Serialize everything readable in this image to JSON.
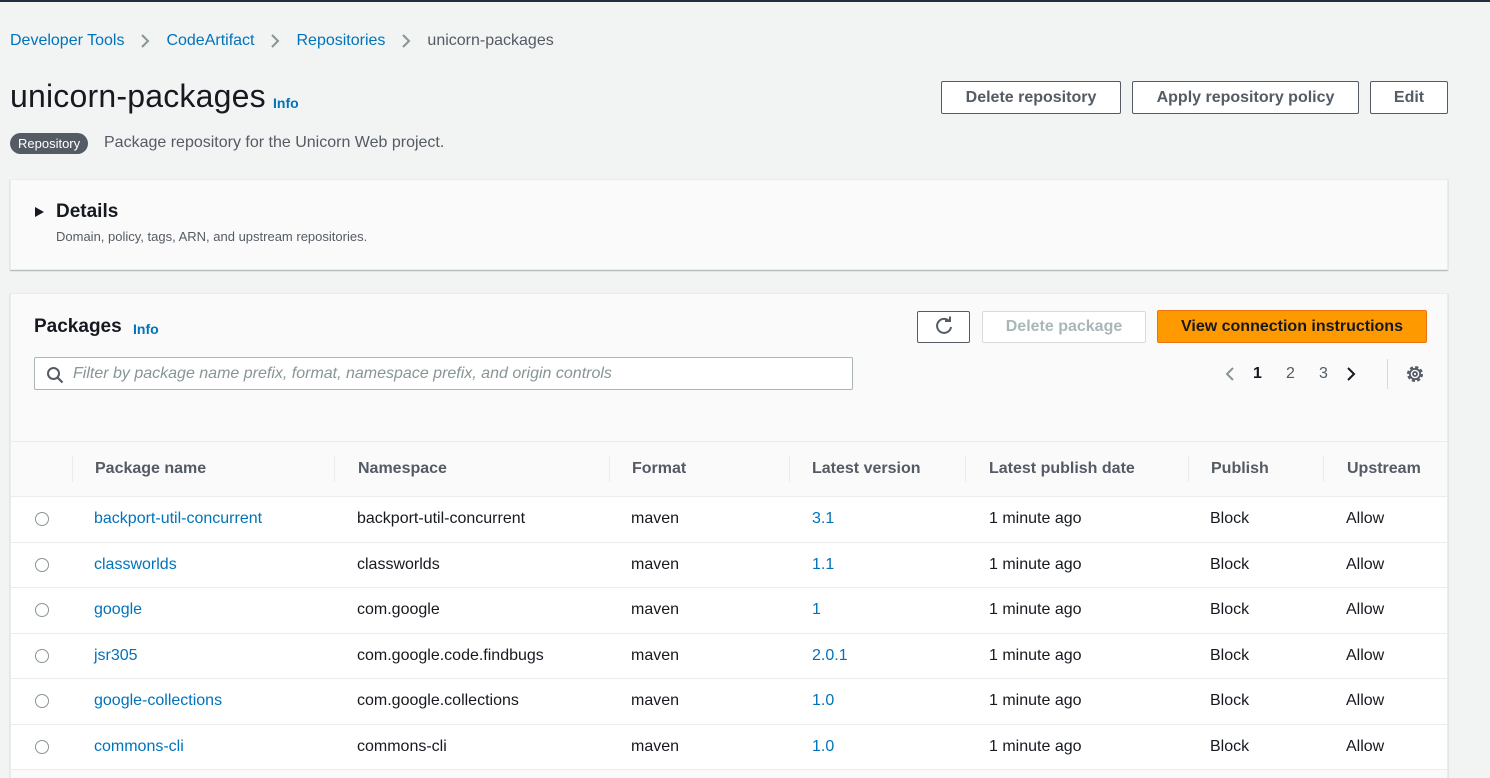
{
  "breadcrumb": {
    "items": [
      "Developer Tools",
      "CodeArtifact",
      "Repositories"
    ],
    "current": "unicorn-packages"
  },
  "header": {
    "title": "unicorn-packages",
    "info_label": "Info",
    "badge": "Repository",
    "description": "Package repository for the Unicorn Web project.",
    "buttons": {
      "delete": "Delete repository",
      "apply_policy": "Apply repository policy",
      "edit": "Edit"
    }
  },
  "details": {
    "title": "Details",
    "description": "Domain, policy, tags, ARN, and upstream repositories."
  },
  "packages": {
    "title": "Packages",
    "info_label": "Info",
    "delete_button": "Delete package",
    "connect_button": "View connection instructions",
    "filter_placeholder": "Filter by package name prefix, format, namespace prefix, and origin controls",
    "pagination": {
      "pages": [
        "1",
        "2",
        "3"
      ],
      "current": "1"
    },
    "columns": [
      "Package name",
      "Namespace",
      "Format",
      "Latest version",
      "Latest publish date",
      "Publish",
      "Upstream"
    ],
    "rows": [
      {
        "name": "backport-util-concurrent",
        "namespace": "backport-util-concurrent",
        "format": "maven",
        "version": "3.1",
        "date": "1 minute ago",
        "publish": "Block",
        "upstream": "Allow"
      },
      {
        "name": "classworlds",
        "namespace": "classworlds",
        "format": "maven",
        "version": "1.1",
        "date": "1 minute ago",
        "publish": "Block",
        "upstream": "Allow"
      },
      {
        "name": "google",
        "namespace": "com.google",
        "format": "maven",
        "version": "1",
        "date": "1 minute ago",
        "publish": "Block",
        "upstream": "Allow"
      },
      {
        "name": "jsr305",
        "namespace": "com.google.code.findbugs",
        "format": "maven",
        "version": "2.0.1",
        "date": "1 minute ago",
        "publish": "Block",
        "upstream": "Allow"
      },
      {
        "name": "google-collections",
        "namespace": "com.google.collections",
        "format": "maven",
        "version": "1.0",
        "date": "1 minute ago",
        "publish": "Block",
        "upstream": "Allow"
      },
      {
        "name": "commons-cli",
        "namespace": "commons-cli",
        "format": "maven",
        "version": "1.0",
        "date": "1 minute ago",
        "publish": "Block",
        "upstream": "Allow"
      }
    ]
  },
  "icons": {
    "breadcrumb_separator": "chevron-right-icon",
    "refresh": "refresh-icon",
    "search": "search-icon",
    "prev": "chevron-left-icon",
    "next": "chevron-right-icon",
    "settings": "gear-icon",
    "expand": "caret-right-icon"
  },
  "colors": {
    "link": "#0073bb",
    "primary_button": "#ff9900",
    "badge": "#545b64",
    "background": "#f2f3f3"
  }
}
